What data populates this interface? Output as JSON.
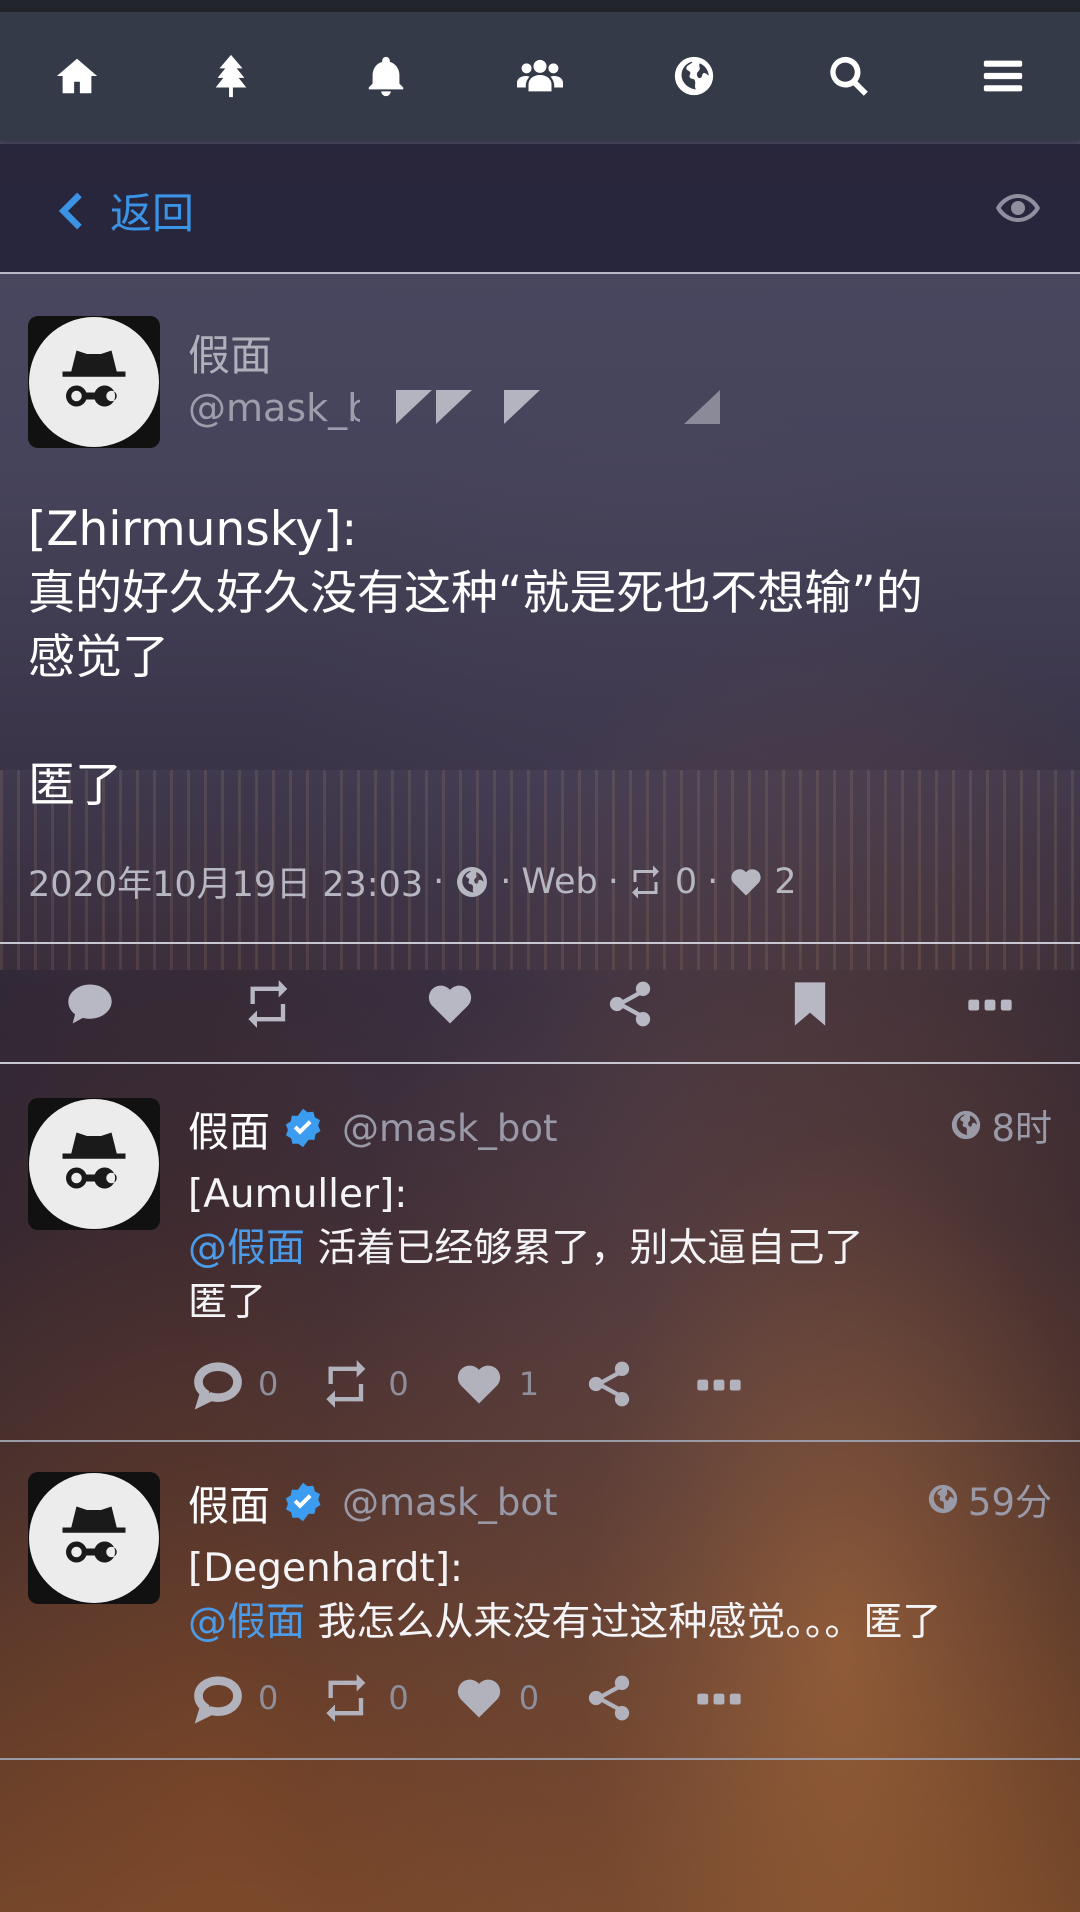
{
  "nav": {
    "icons": [
      "home-icon",
      "tree-icon",
      "bell-icon",
      "users-icon",
      "globe-icon",
      "search-icon",
      "menu-icon"
    ]
  },
  "subbar": {
    "back_label": "返回"
  },
  "main_post": {
    "display_name": "假面",
    "handle": "@mask_bot",
    "text": "[Zhirmunsky]:\n真的好久好久没有这种“就是死也不想输”的\n感觉了\n\n匿了",
    "timestamp": "2020年10月19日 23:03",
    "sep": "·",
    "client": "Web",
    "reposts": "0",
    "likes": "2"
  },
  "replies": [
    {
      "display_name": "假面",
      "handle": "@mask_bot",
      "time": "8时",
      "prefix": "[Aumuller]:",
      "mention": "@假面",
      "text": " 活着已经够累了，别太逼自己了",
      "line3": "匿了",
      "comments": "0",
      "reposts": "0",
      "likes": "1"
    },
    {
      "display_name": "假面",
      "handle": "@mask_bot",
      "time": "59分",
      "prefix": "[Degenhardt]:",
      "mention": "@假面",
      "text": " 我怎么从来没有过这种感觉。。。匿了",
      "comments": "0",
      "reposts": "0",
      "likes": "0"
    }
  ],
  "colors": {
    "nav_bg": "#353a48",
    "accent": "#3b93e6",
    "verified": "#3b9cf0"
  }
}
